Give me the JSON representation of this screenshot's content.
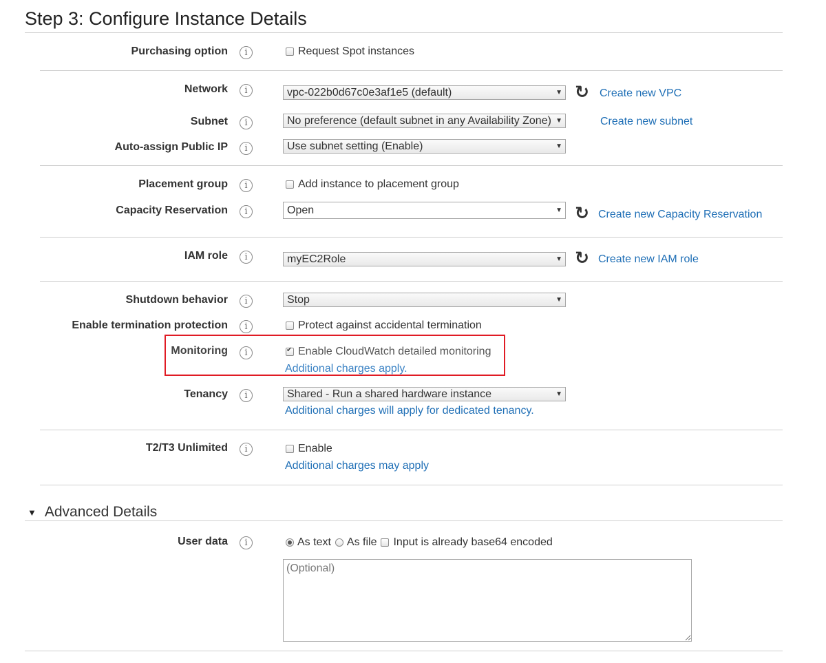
{
  "page": {
    "title": "Step 3: Configure Instance Details"
  },
  "purchasing": {
    "label": "Purchasing option",
    "checkbox_label": "Request Spot instances",
    "checked": false
  },
  "network": {
    "label": "Network",
    "value": "vpc-022b0d67c0e3af1e5 (default)",
    "link": "Create new VPC"
  },
  "subnet": {
    "label": "Subnet",
    "value": "No preference (default subnet in any Availability Zone)",
    "link": "Create new subnet"
  },
  "public_ip": {
    "label": "Auto-assign Public IP",
    "value": "Use subnet setting (Enable)"
  },
  "placement": {
    "label": "Placement group",
    "checkbox_label": "Add instance to placement group",
    "checked": false
  },
  "capacity": {
    "label": "Capacity Reservation",
    "value": "Open",
    "link": "Create new Capacity Reservation"
  },
  "iam": {
    "label": "IAM role",
    "value": "myEC2Role",
    "link": "Create new IAM role"
  },
  "shutdown": {
    "label": "Shutdown behavior",
    "value": "Stop"
  },
  "termination": {
    "label": "Enable termination protection",
    "checkbox_label": "Protect against accidental termination",
    "checked": false
  },
  "monitoring": {
    "label": "Monitoring",
    "checkbox_label": "Enable CloudWatch detailed monitoring",
    "checked": true,
    "note": "Additional charges apply.",
    "highlight_color": "#e01b24"
  },
  "tenancy": {
    "label": "Tenancy",
    "value": "Shared - Run a shared hardware instance",
    "note": "Additional charges will apply for dedicated tenancy."
  },
  "unlimited": {
    "label": "T2/T3 Unlimited",
    "checkbox_label": "Enable",
    "checked": false,
    "note": "Additional charges may apply"
  },
  "advanced": {
    "title": "Advanced Details"
  },
  "userdata": {
    "label": "User data",
    "option_text": "As text",
    "option_file": "As file",
    "base64_label": "Input is already base64 encoded",
    "selected": "As text",
    "placeholder": "(Optional)"
  },
  "icons": {
    "info": "info-icon",
    "refresh": "refresh-icon",
    "dropdown": "chevron-down-icon",
    "expand": "triangle-down-icon"
  },
  "colors": {
    "link": "#1f6fb6",
    "highlight": "#e01b24",
    "divider": "#cfcfcf"
  }
}
